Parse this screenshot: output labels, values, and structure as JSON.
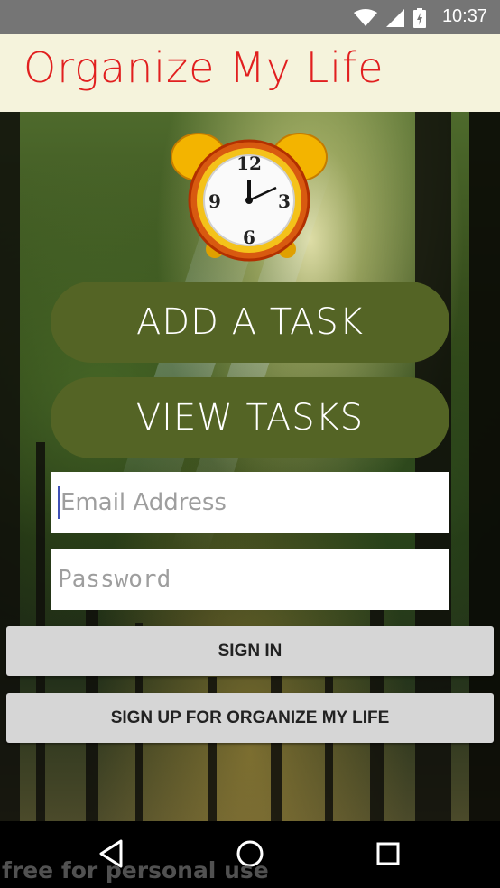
{
  "status_bar": {
    "time": "10:37"
  },
  "app_bar": {
    "title": "Organize My Life"
  },
  "clock": {
    "numbers": [
      "12",
      "3",
      "6",
      "9"
    ]
  },
  "buttons": {
    "add_task": "ADD A TASK",
    "view_tasks": "VIEW TASKS",
    "sign_in": "SIGN IN",
    "sign_up": "SIGN UP FOR ORGANIZE MY LIFE"
  },
  "form": {
    "email_placeholder": "Email Address",
    "password_placeholder": "Password"
  },
  "colors": {
    "title": "#e11f1f",
    "app_bar_bg": "#f5f3dc",
    "pill_button": "#546425",
    "flat_button": "#d6d6d6"
  },
  "footer": {
    "watermark": "free for personal use"
  }
}
